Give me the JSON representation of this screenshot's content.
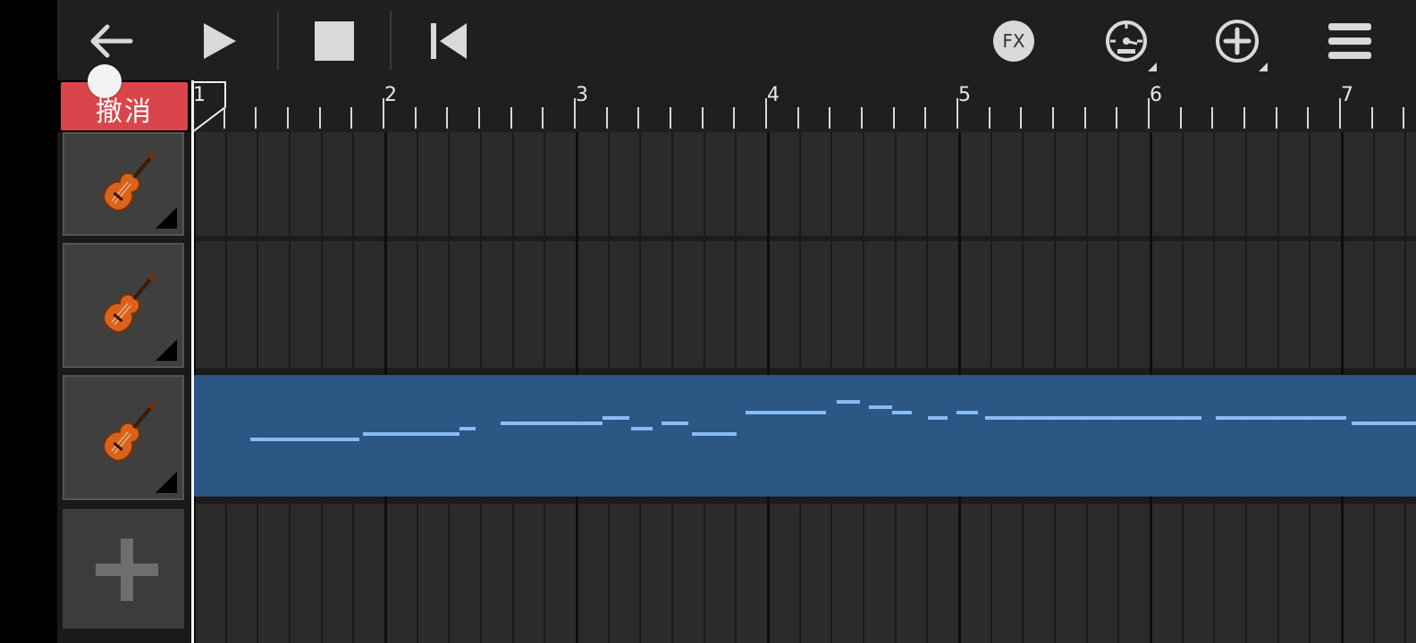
{
  "toolbar": {
    "back_icon": "back-arrow-icon",
    "play_icon": "play-icon",
    "stop_icon": "stop-icon",
    "rewind_icon": "skip-to-start-icon",
    "fx_label": "FX",
    "tempo_icon": "metronome-icon",
    "add_icon": "add-circle-icon",
    "menu_icon": "hamburger-menu-icon"
  },
  "undo": {
    "label": "撤消"
  },
  "ruler": {
    "bars": [
      "1",
      "2",
      "3",
      "4",
      "5",
      "6",
      "7"
    ]
  },
  "tracks": [
    {
      "instrument": "violin",
      "icon": "violin-icon",
      "selected": false
    },
    {
      "instrument": "violin",
      "icon": "violin-icon",
      "selected": false
    },
    {
      "instrument": "violin",
      "icon": "violin-icon",
      "selected": true
    }
  ],
  "add_track": {
    "icon": "plus-icon"
  },
  "colors": {
    "toolbar_bg": "#1f1f1f",
    "undo_bg": "#d9454a",
    "region_blue": "#2c5a8a",
    "note_blue": "#8cc4ff"
  }
}
